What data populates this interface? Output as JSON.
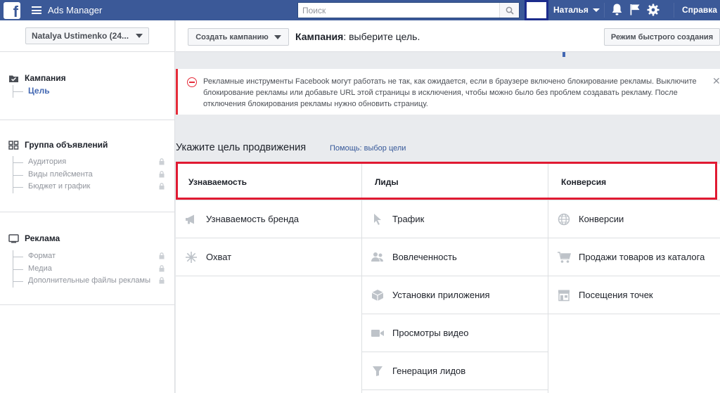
{
  "topbar": {
    "logo": "f",
    "app_title": "Ads Manager",
    "search_placeholder": "Поиск",
    "user_name": "Наталья",
    "help_label": "Справка",
    "icons": [
      "facebook-logo-icon",
      "menu-icon",
      "search-icon",
      "bell-icon",
      "flag-icon",
      "gear-icon"
    ]
  },
  "sidebar": {
    "account_label": "Natalya Ustimenko (24...",
    "campaign": {
      "title": "Кампания",
      "items": [
        {
          "label": "Цель",
          "active": true
        }
      ]
    },
    "adset": {
      "title": "Группа объявлений",
      "items": [
        {
          "label": "Аудитория"
        },
        {
          "label": "Виды плейсмента"
        },
        {
          "label": "Бюджет и график"
        }
      ]
    },
    "ad": {
      "title": "Реклама",
      "items": [
        {
          "label": "Формат"
        },
        {
          "label": "Медиа"
        },
        {
          "label": "Дополнительные файлы рекламы"
        }
      ]
    }
  },
  "header": {
    "create_label": "Создать кампанию",
    "title_bold": "Кампания",
    "title_rest": ": выберите цель.",
    "quick_label": "Режим быстрого создания"
  },
  "warning": {
    "text": "Рекламные инструменты Facebook могут работать не так, как ожидается, если в браузере включено блокирование рекламы. Выключите блокирование рекламы или добавьте URL этой страницы в исключения, чтобы можно было без проблем создавать рекламу. После отключения блокирования рекламы нужно обновить страницу.",
    "close": "✕"
  },
  "objective": {
    "title": "Укажите цель продвижения",
    "help_link": "Помощь: выбор цели",
    "columns": [
      {
        "title": "Узнаваемость",
        "options": [
          {
            "label": "Узнаваемость бренда",
            "icon": "megaphone-icon"
          },
          {
            "label": "Охват",
            "icon": "reach-icon"
          }
        ]
      },
      {
        "title": "Лиды",
        "options": [
          {
            "label": "Трафик",
            "icon": "cursor-icon"
          },
          {
            "label": "Вовлеченность",
            "icon": "people-icon"
          },
          {
            "label": "Установки приложения",
            "icon": "box-icon"
          },
          {
            "label": "Просмотры видео",
            "icon": "video-icon"
          },
          {
            "label": "Генерация лидов",
            "icon": "funnel-icon"
          }
        ]
      },
      {
        "title": "Конверсия",
        "options": [
          {
            "label": "Конверсии",
            "icon": "globe-icon"
          },
          {
            "label": "Продажи товаров из каталога",
            "icon": "cart-icon"
          },
          {
            "label": "Посещения точек",
            "icon": "store-icon"
          }
        ]
      }
    ]
  },
  "colors": {
    "brand": "#3b5998",
    "highlight": "#e01a32",
    "link": "#365899"
  }
}
